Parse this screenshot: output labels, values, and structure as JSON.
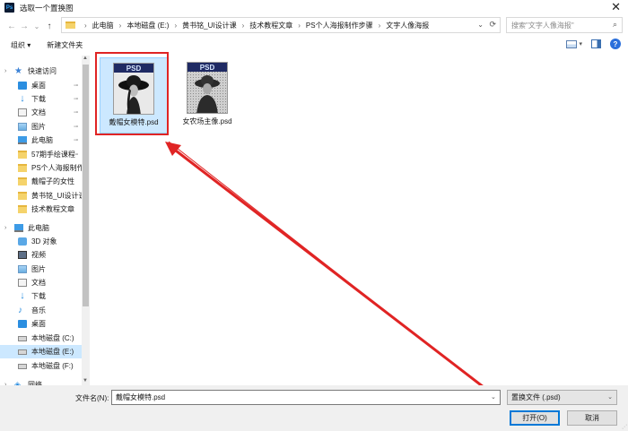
{
  "window": {
    "title": "选取一个置换图",
    "app_icon": "Ps",
    "close_glyph": "✕"
  },
  "nav": {
    "back": "←",
    "forward": "→",
    "recent": "⌄",
    "up": "↑"
  },
  "address": {
    "crumbs": [
      "此电脑",
      "本地磁盘 (E:)",
      "黄书铭_UI设计课",
      "技术教程文章",
      "PS个人海报制作步骤",
      "文字人像海报"
    ],
    "sep": "›",
    "dropdown": "⌄",
    "refresh": "⟳"
  },
  "search": {
    "placeholder": "搜索\"文字人像海报\"",
    "icon": "⌕"
  },
  "toolbar": {
    "organize": "组织 ▾",
    "new_folder": "新建文件夹",
    "view_dd": "▾",
    "help": "?"
  },
  "sidebar": {
    "items": [
      {
        "label": "快速访问",
        "icon": "star-icon",
        "pinned": false
      },
      {
        "label": "桌面",
        "icon": "desktop-icon",
        "pinned": true
      },
      {
        "label": "下载",
        "icon": "download-icon",
        "pinned": true
      },
      {
        "label": "文档",
        "icon": "document-icon",
        "pinned": true
      },
      {
        "label": "图片",
        "icon": "pictures-icon",
        "pinned": true
      },
      {
        "label": "此电脑",
        "icon": "computer-icon",
        "pinned": true
      },
      {
        "label": "57期手绘课程",
        "icon": "folder-icon",
        "pinned": true
      },
      {
        "label": "PS个人海报制作步骤",
        "icon": "folder-icon",
        "pinned": false
      },
      {
        "label": "戴帽子的女性",
        "icon": "folder-icon",
        "pinned": false
      },
      {
        "label": "黄书铭_UI设计课",
        "icon": "folder-icon",
        "pinned": false
      },
      {
        "label": "技术教程文章",
        "icon": "folder-icon",
        "pinned": false
      },
      {
        "label": "此电脑",
        "icon": "computer-icon",
        "pinned": false
      },
      {
        "label": "3D 对象",
        "icon": "3d-objects-icon",
        "pinned": false
      },
      {
        "label": "视频",
        "icon": "video-icon",
        "pinned": false
      },
      {
        "label": "图片",
        "icon": "pictures-icon",
        "pinned": false
      },
      {
        "label": "文档",
        "icon": "document-icon",
        "pinned": false
      },
      {
        "label": "下载",
        "icon": "download-icon",
        "pinned": false
      },
      {
        "label": "音乐",
        "icon": "music-icon",
        "pinned": false
      },
      {
        "label": "桌面",
        "icon": "desktop-icon",
        "pinned": false
      },
      {
        "label": "本地磁盘 (C:)",
        "icon": "drive-icon",
        "pinned": false
      },
      {
        "label": "本地磁盘 (E:)",
        "icon": "drive-icon",
        "pinned": false
      },
      {
        "label": "本地磁盘 (F:)",
        "icon": "drive-icon",
        "pinned": false
      },
      {
        "label": "网络",
        "icon": "network-icon",
        "pinned": false
      }
    ],
    "pin_glyph": "📌",
    "expand_glyph": "›"
  },
  "files": [
    {
      "name": "戴帽女模特.psd",
      "badge": "PSD",
      "selected": true
    },
    {
      "name": "女农场主像.psd",
      "badge": "PSD",
      "selected": false
    }
  ],
  "footer": {
    "filename_label": "文件名(N):",
    "filename_value": "戴帽女模特.psd",
    "filetype_value": "置换文件 (.psd)",
    "open_button": "打开(O)",
    "cancel_button": "取消"
  },
  "colors": {
    "highlight_red": "#e02424",
    "selection_blue": "#cce8ff",
    "psd_badge": "#1f2a63"
  }
}
